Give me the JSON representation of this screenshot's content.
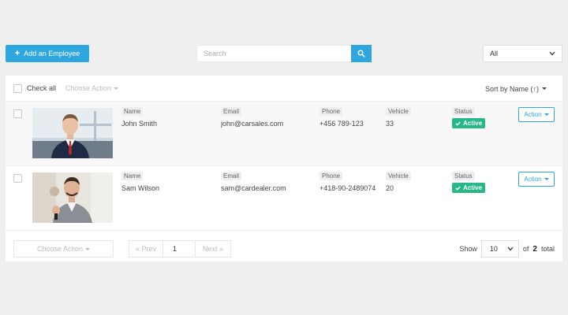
{
  "toolbar_top": {
    "add_label": "Add an Employee",
    "search_placeholder": "Search",
    "filter_value": "All"
  },
  "list_header": {
    "check_all_label": "Check all",
    "choose_action_label": "Choose Action",
    "sort_label": "Sort by Name (↑)"
  },
  "columns": {
    "name": "Name",
    "email": "Email",
    "phone": "Phone",
    "vehicle": "Vehicle",
    "status": "Status"
  },
  "employees": [
    {
      "name": "John Smith",
      "email": "john@carsales.com",
      "phone": "+456 789-123",
      "vehicle": "33",
      "status": "Active",
      "action": "Action"
    },
    {
      "name": "Sam Wilson",
      "email": "sam@cardealer.com",
      "phone": "+418-90-2489074",
      "vehicle": "20",
      "status": "Active",
      "action": "Action"
    }
  ],
  "footer": {
    "choose_action_label": "Choose Action",
    "prev_label": "« Prev",
    "page_value": "1",
    "next_label": "Next »",
    "show_label": "Show",
    "per_page_value": "10",
    "of_label": "of",
    "total_pages": "2",
    "total_label": "total"
  },
  "colors": {
    "accent": "#2ea6df",
    "status_active": "#27b88a"
  },
  "icons": {
    "add": "plus-icon",
    "search": "search-icon",
    "status": "check-icon",
    "dropdown": "chevron-down-icon"
  }
}
